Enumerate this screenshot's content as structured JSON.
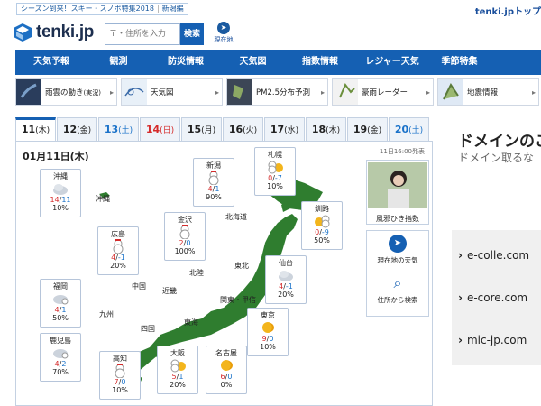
{
  "promo": {
    "text1": "シーズン到来！スキー・スノボ特集2018",
    "text2": "新潟編"
  },
  "brand_right": "tenki.jpトップ",
  "logo_text": "tenki.jp",
  "search": {
    "placeholder": "〒・住所を入力",
    "button": "検索"
  },
  "current_location": "現在地",
  "nav": [
    "天気予報",
    "観測",
    "防災情報",
    "天気図",
    "指数情報",
    "レジャー天気",
    "季節特集"
  ],
  "subnav": [
    "雨雲の動き",
    "天気図",
    "PM2.5分布予測",
    "豪雨レーダー",
    "地震情報"
  ],
  "subnav_suffix": "(実況)",
  "tabs": [
    {
      "day": "11",
      "wd": "(木)",
      "cls": "active"
    },
    {
      "day": "12",
      "wd": "(金)",
      "cls": ""
    },
    {
      "day": "13",
      "wd": "(土)",
      "cls": "sat"
    },
    {
      "day": "14",
      "wd": "(日)",
      "cls": "sun"
    },
    {
      "day": "15",
      "wd": "(月)",
      "cls": ""
    },
    {
      "day": "16",
      "wd": "(火)",
      "cls": ""
    },
    {
      "day": "17",
      "wd": "(水)",
      "cls": ""
    },
    {
      "day": "18",
      "wd": "(木)",
      "cls": ""
    },
    {
      "day": "19",
      "wd": "(金)",
      "cls": ""
    },
    {
      "day": "20",
      "wd": "(土)",
      "cls": "sat"
    }
  ],
  "date_label": "01月11日(木)",
  "issued": "11日16:00発表",
  "cities": [
    {
      "name": "沖縄",
      "hi": "14",
      "lo": "11",
      "pop": "10%",
      "icon": "cloud-icon"
    },
    {
      "name": "新潟",
      "hi": "4",
      "lo": "1",
      "pop": "90%",
      "icon": "snow-icon"
    },
    {
      "name": "札幌",
      "hi": "0",
      "lo": "-7",
      "pop": "10%",
      "icon": "snow-sun-icon"
    },
    {
      "name": "金沢",
      "hi": "2",
      "lo": "0",
      "pop": "100%",
      "icon": "snow-icon"
    },
    {
      "name": "釧路",
      "hi": "0",
      "lo": "-9",
      "pop": "50%",
      "icon": "sun-snow-icon"
    },
    {
      "name": "広島",
      "hi": "4",
      "lo": "-1",
      "pop": "20%",
      "icon": "snow-icon"
    },
    {
      "name": "仙台",
      "hi": "4",
      "lo": "-1",
      "pop": "20%",
      "icon": "cloud-icon"
    },
    {
      "name": "福岡",
      "hi": "4",
      "lo": "1",
      "pop": "50%",
      "icon": "cloud-snow-icon"
    },
    {
      "name": "東京",
      "hi": "9",
      "lo": "0",
      "pop": "10%",
      "icon": "sun-icon"
    },
    {
      "name": "鹿児島",
      "hi": "4",
      "lo": "2",
      "pop": "70%",
      "icon": "cloud-snow-icon"
    },
    {
      "name": "高知",
      "hi": "7",
      "lo": "0",
      "pop": "10%",
      "icon": "snow-icon"
    },
    {
      "name": "大阪",
      "hi": "5",
      "lo": "1",
      "pop": "20%",
      "icon": "snow-sun-icon"
    },
    {
      "name": "名古屋",
      "hi": "6",
      "lo": "0",
      "pop": "0%",
      "icon": "sun-icon"
    }
  ],
  "regions": [
    "沖縄",
    "北海道",
    "東北",
    "北陸",
    "関東・甲信",
    "中国",
    "近畿",
    "東海",
    "九州",
    "四国"
  ],
  "side": {
    "flu": "風邪ひき指数",
    "current_weather": "現在地の天気",
    "search_address": "住所から検索"
  },
  "ad": {
    "title": "ドメインのこ",
    "subtitle": "ドメイン取るな",
    "links": [
      "e-colle.com",
      "e-core.com",
      "mic-jp.com"
    ]
  },
  "colors": {
    "brand": "#1560b3",
    "high": "#d52b2b",
    "low": "#1a72c9"
  }
}
